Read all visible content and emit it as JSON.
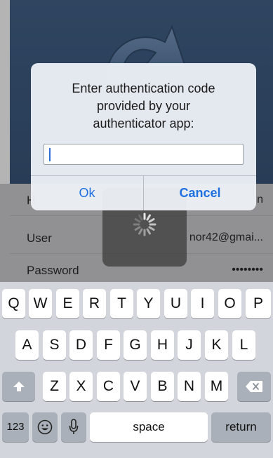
{
  "background": {
    "rows": [
      {
        "label": "H",
        "value": "n"
      },
      {
        "label": "User",
        "value": "nor42@gmai..."
      },
      {
        "label": "Password",
        "value": "••••••••"
      }
    ]
  },
  "alert": {
    "title_line1": "Enter authentication code",
    "title_line2": "provided by your",
    "title_line3": "authenticator app:",
    "input_value": "",
    "ok_label": "Ok",
    "cancel_label": "Cancel"
  },
  "keyboard": {
    "row1": [
      "Q",
      "W",
      "E",
      "R",
      "T",
      "Y",
      "U",
      "I",
      "O",
      "P"
    ],
    "row2": [
      "A",
      "S",
      "D",
      "F",
      "G",
      "H",
      "J",
      "K",
      "L"
    ],
    "row3": [
      "Z",
      "X",
      "C",
      "V",
      "B",
      "N",
      "M"
    ],
    "numbers_label": "123",
    "space_label": "space",
    "return_label": "return",
    "shift_icon": "shift-icon",
    "delete_icon": "delete-icon",
    "emoji_icon": "emoji-icon",
    "mic_icon": "microphone-icon"
  },
  "colors": {
    "accent": "#1e6fe0",
    "hero": "#2d4d76",
    "keyboard_bg": "#d2d5db",
    "special_key": "#aab0b9"
  }
}
